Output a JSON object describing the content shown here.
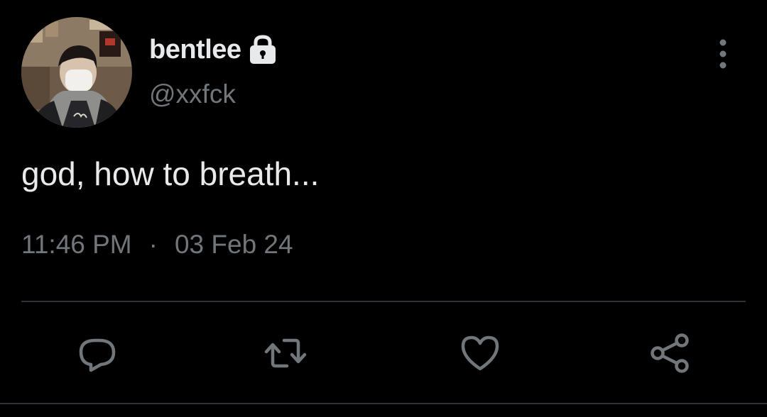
{
  "user": {
    "display_name": "bentlee",
    "handle": "@xxfck",
    "protected_icon": "lock-icon",
    "avatar": "profile-photo"
  },
  "tweet": {
    "text": "god, how to breath...",
    "time": "11:46 PM",
    "separator": "·",
    "date": "03 Feb 24"
  },
  "actions": [
    {
      "name": "reply",
      "icon": "reply-icon"
    },
    {
      "name": "retweet",
      "icon": "retweet-icon"
    },
    {
      "name": "like",
      "icon": "heart-icon"
    },
    {
      "name": "share",
      "icon": "share-icon"
    }
  ],
  "menu_icon": "more-vertical-icon",
  "colors": {
    "background": "#000000",
    "primary_text": "#e7e9ea",
    "secondary_text": "#71767b",
    "divider": "#2f3336"
  }
}
